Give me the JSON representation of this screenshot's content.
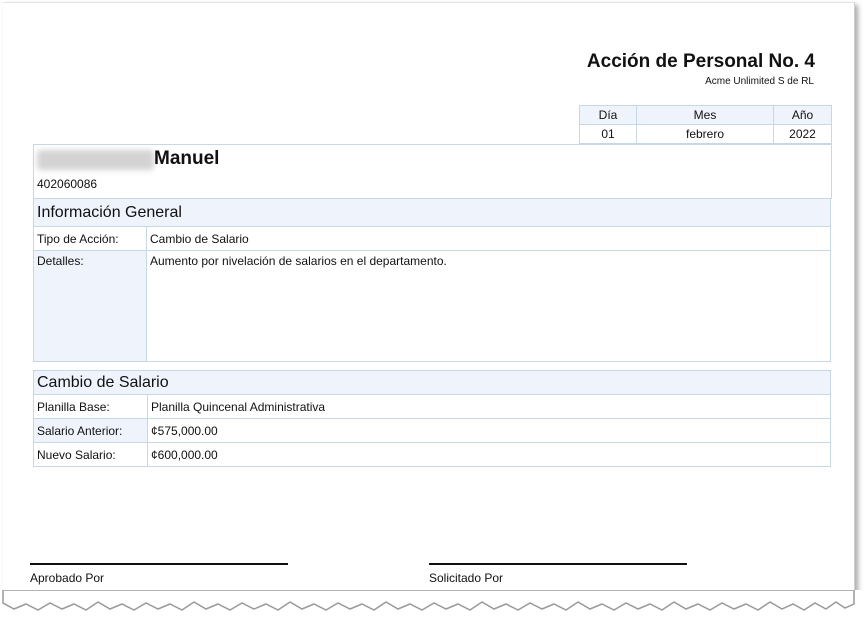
{
  "header": {
    "title": "Acción de Personal No. 4",
    "company": "Acme Unlimited S de RL"
  },
  "date": {
    "labels": [
      "Día",
      "Mes",
      "Año"
    ],
    "values": [
      "01",
      "febrero",
      "2022"
    ]
  },
  "employee": {
    "name": "Manuel",
    "id": "402060086"
  },
  "general": {
    "heading": "Información General",
    "action_type_label": "Tipo de Acción:",
    "action_type_value": "Cambio de Salario",
    "details_label": "Detalles:",
    "details_value": "Aumento por nivelación de salarios en el  departamento."
  },
  "salary": {
    "heading": "Cambio de Salario",
    "rows": [
      {
        "label": "Planilla Base:",
        "value": "Planilla Quincenal Administrativa"
      },
      {
        "label": "Salario Anterior:",
        "value": "¢575,000.00"
      },
      {
        "label": "Nuevo Salario:",
        "value": "¢600,000.00"
      }
    ]
  },
  "signatures": {
    "approved_by": "Aprobado Por",
    "requested_by": "Solicitado Por"
  }
}
